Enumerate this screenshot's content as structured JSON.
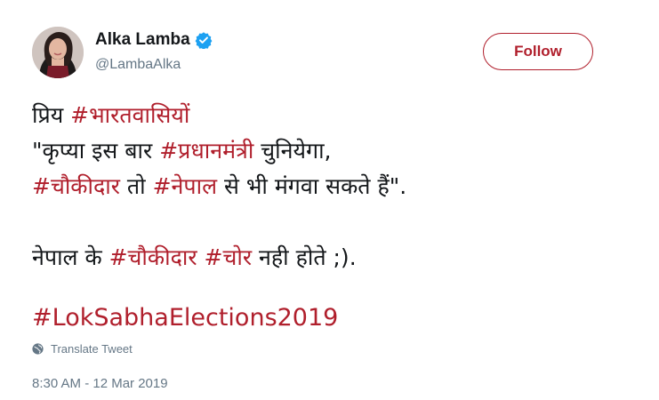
{
  "colors": {
    "accent": "#b01f2c",
    "text": "#14171a",
    "muted": "#657786",
    "verified": "#1da1f2"
  },
  "author": {
    "display_name": "Alka Lamba",
    "handle": "@LambaAlka",
    "avatar_icon": "profile-photo",
    "verified_icon": "verified-badge-icon"
  },
  "follow_label": "Follow",
  "tweet": {
    "line1": {
      "t1": "प्रिय ",
      "h1": "#भारतवासियों"
    },
    "line2": {
      "t1": "\"कृप्या इस बार ",
      "h1": "#प्रधानमंत्री",
      "t2": " चुनियेगा,"
    },
    "line3": {
      "h1": "#चौकीदार",
      "t1": " तो ",
      "h2": "#नेपाल",
      "t2": " से भी मंगवा सकते हैं\"."
    },
    "line5": {
      "t1": "नेपाल के ",
      "h1": "#चौकीदार",
      "t2": " ",
      "h2": "#चोर",
      "t3": " नही होते ;)."
    },
    "line7": {
      "h1": "#LokSabhaElections2019"
    }
  },
  "translate_label": "Translate Tweet",
  "timestamp": "8:30 AM - 12 Mar 2019"
}
